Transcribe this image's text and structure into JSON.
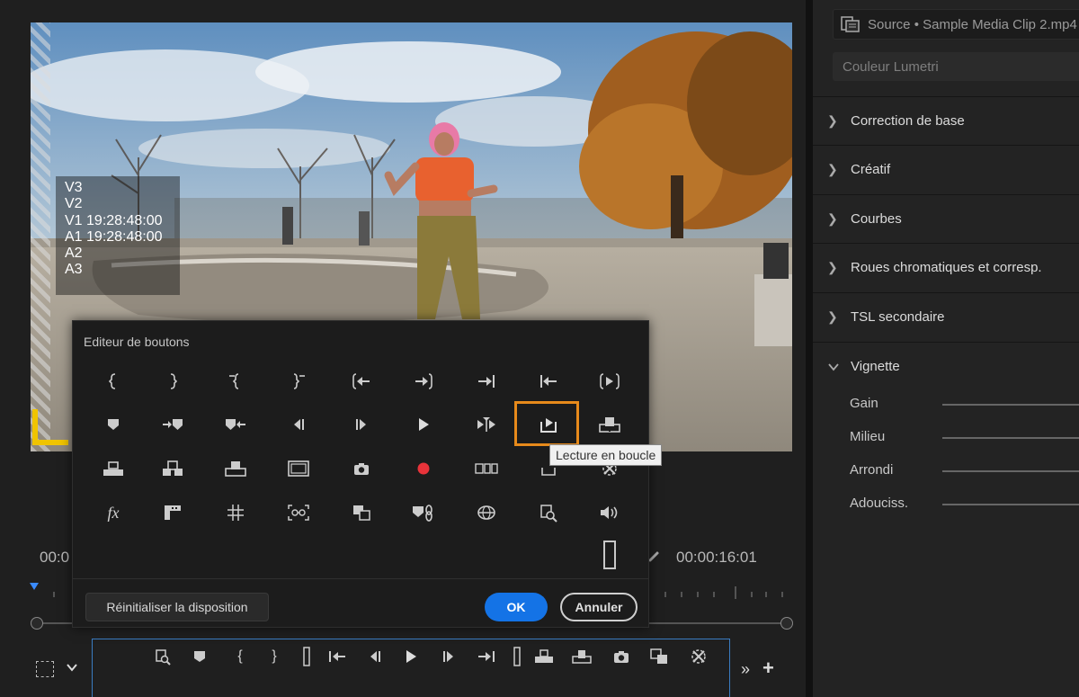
{
  "source_panel": {
    "source_title": "Source • Sample Media Clip 2.mp4",
    "lumetri_label": "Couleur Lumetri",
    "sections": [
      {
        "label": "Correction de base",
        "expanded": false
      },
      {
        "label": "Créatif",
        "expanded": false
      },
      {
        "label": "Courbes",
        "expanded": false
      },
      {
        "label": "Roues chromatiques et corresp.",
        "expanded": false
      },
      {
        "label": "TSL secondaire",
        "expanded": false
      },
      {
        "label": "Vignette",
        "expanded": true
      }
    ],
    "vignette_controls": [
      "Gain",
      "Milieu",
      "Arrondi",
      "Adouciss."
    ]
  },
  "monitor": {
    "overlay_lines": [
      "V3",
      "V2",
      "V1 19:28:48:00",
      "A1 19:28:48:00",
      "A2",
      "A3"
    ],
    "timecode_left": "00:0",
    "timecode_right": "00:00:16:01"
  },
  "dialog": {
    "title": "Editeur de boutons",
    "reset_label": "Réinitialiser la disposition",
    "ok_label": "OK",
    "cancel_label": "Annuler",
    "tooltip": "Lecture en boucle",
    "fx_label": "fx"
  },
  "colors": {
    "accent_blue": "#1473e6",
    "highlight_orange": "#e78a1b",
    "record_red": "#e8333a",
    "safe_margin_yellow": "#f0c400"
  }
}
